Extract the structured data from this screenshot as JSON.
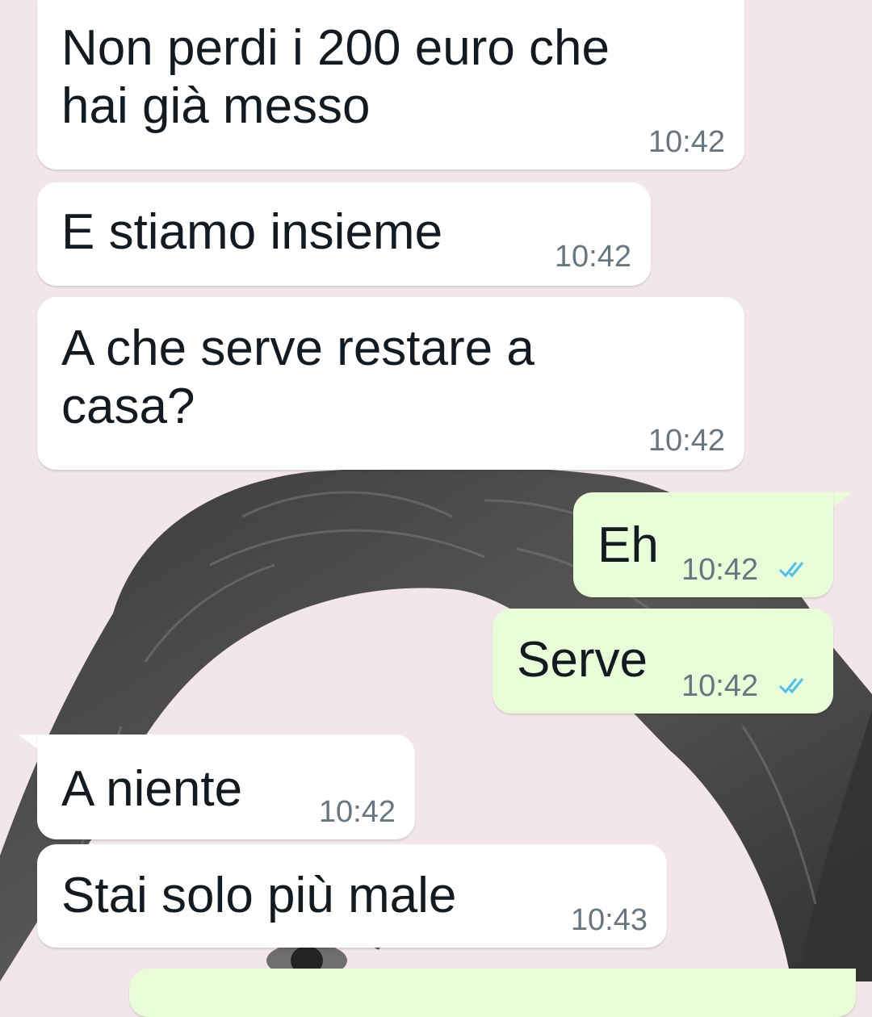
{
  "conversation": {
    "messages": [
      {
        "direction": "incoming",
        "text": "Non perdi i 200 euro che\nhai già messo",
        "time": "10:42"
      },
      {
        "direction": "incoming",
        "text": "E stiamo insieme",
        "time": "10:42"
      },
      {
        "direction": "incoming",
        "text": "A che serve restare a\ncasa?",
        "time": "10:42"
      },
      {
        "direction": "outgoing",
        "text": "Eh",
        "time": "10:42",
        "status_icon": "double-check-read-icon"
      },
      {
        "direction": "outgoing",
        "text": "Serve",
        "time": "10:42",
        "status_icon": "double-check-read-icon"
      },
      {
        "direction": "incoming",
        "text": "A niente",
        "time": "10:42"
      },
      {
        "direction": "incoming",
        "text": "Stai solo più male",
        "time": "10:43"
      }
    ]
  },
  "colors": {
    "wallpaper": "#f2e6ea",
    "incoming_bubble": "#ffffff",
    "outgoing_bubble": "#e7fcd7",
    "read_ticks": "#53bdeb",
    "timestamp": "#667781"
  },
  "wallpaper": {
    "icon": "hair-portrait-sketch"
  }
}
